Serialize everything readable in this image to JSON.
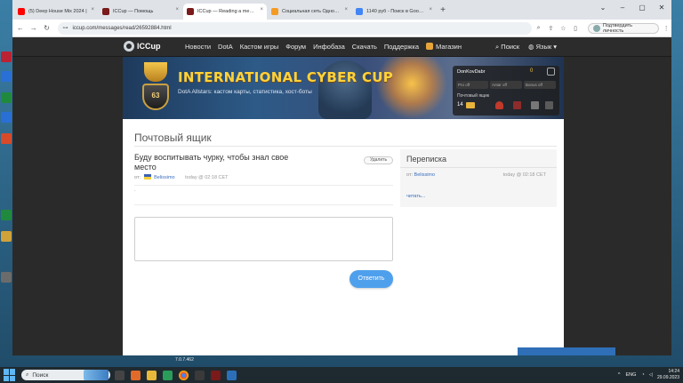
{
  "browser": {
    "tabs": [
      {
        "label": "(5) Deep House Mix 2024 |",
        "favicon_color": "#ff0000",
        "active": false
      },
      {
        "label": "ICCup — Помощь",
        "favicon_color": "#7a1a1a",
        "active": false
      },
      {
        "label": "ICCup — Reading a message fr",
        "favicon_color": "#7a1a1a",
        "active": true
      },
      {
        "label": "Социальная сеть Одноклассн",
        "favicon_color": "#f59a23",
        "active": false
      },
      {
        "label": "1140 руб - Поиск в Google",
        "favicon_color": "#4285f4",
        "active": false
      }
    ],
    "url": "iccup.com/messages/read/26592884.html",
    "confirm_label": "Подтвердить личность"
  },
  "site": {
    "logo_text": "ICCup",
    "menu": [
      "Новости",
      "DotA",
      "Кастом игры",
      "Форум",
      "Инфобаза",
      "Скачать",
      "Поддержка",
      "Магазин"
    ],
    "search_label": "Поиск",
    "lang_label": "Язык",
    "banner": {
      "title": "INTERNATIONAL CYBER CUP",
      "subtitle": "DotA Allstars: кастом карты, статистика, хост-боты",
      "level": "63"
    },
    "user_panel": {
      "username": "DonKovDabr",
      "gold": "0",
      "chips": [
        "Pro off",
        "Antar off",
        "Bonus off"
      ],
      "mailbox_label": "Почтовый ящик",
      "mail_count": "14"
    }
  },
  "mailbox": {
    "title": "Почтовый ящик",
    "message": {
      "subject": "Буду воспитывать чурку, чтобы знал свое место",
      "delete_label": "Удалить",
      "from_label": "от:",
      "sender": "Belissimo",
      "time": "today @ 02:18 CET",
      "body": "."
    },
    "reply_placeholder": "",
    "reply_label": "Ответить",
    "conversation": {
      "title": "Переписка",
      "from_label": "от:",
      "sender": "Belissimo",
      "time": "today @ 02:18 CET",
      "read_label": "читать..."
    }
  },
  "desktop": {
    "version_text": "7.0.7.462"
  },
  "taskbar": {
    "search_label": "Поиск",
    "lang": "ENG",
    "time": "14:24",
    "date": "29.09.2023"
  }
}
